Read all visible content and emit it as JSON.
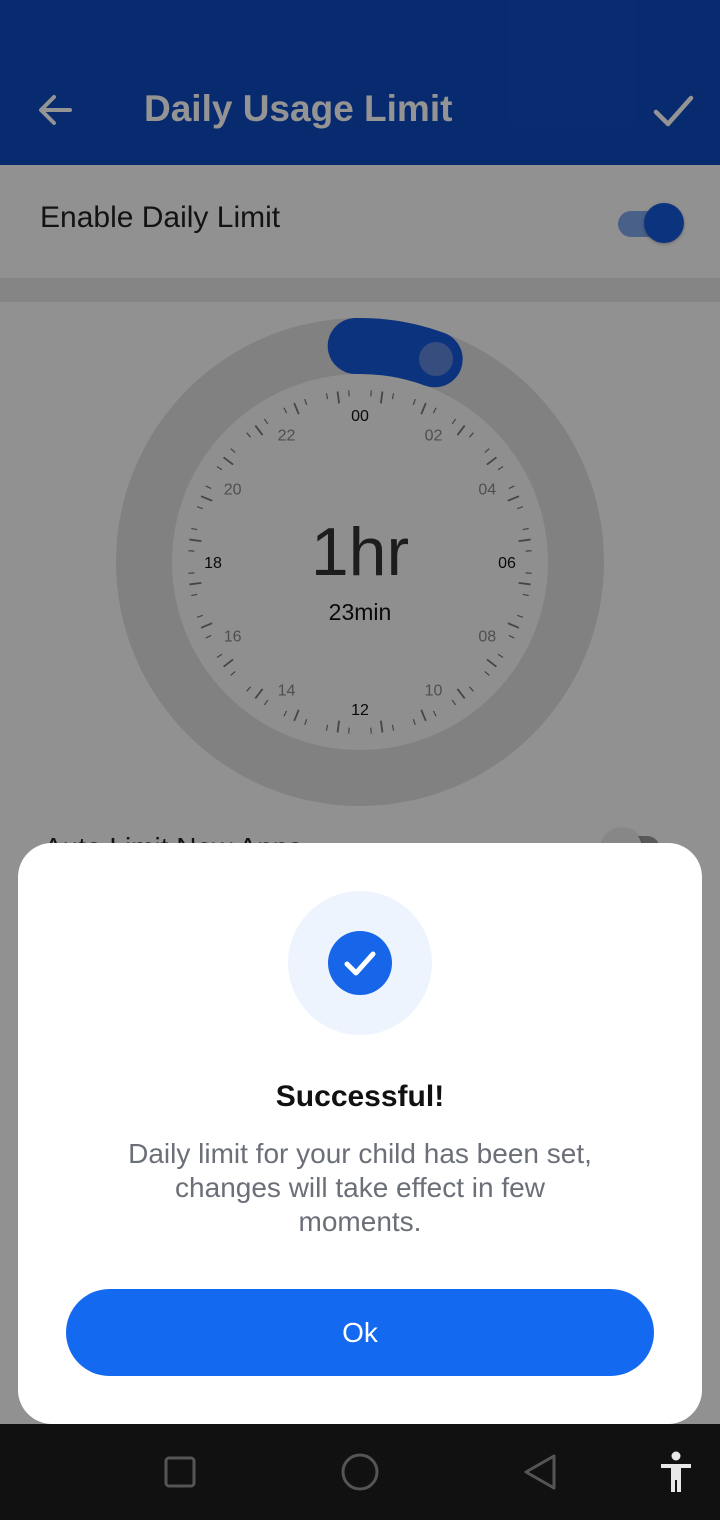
{
  "header": {
    "title": "Daily Usage Limit",
    "back_icon": "arrow-left-icon",
    "confirm_icon": "check-icon",
    "bg": "#0f4ac0"
  },
  "settings": {
    "enable_label": "Enable Daily Limit",
    "enable_on": true,
    "auto_label": "Auto Limit New Apps",
    "auto_on": false
  },
  "dial": {
    "hours_labels": [
      "00",
      "02",
      "04",
      "06",
      "08",
      "10",
      "12",
      "14",
      "16",
      "18",
      "20",
      "22"
    ],
    "value_main": "1hr",
    "value_sub": "23min",
    "accent": "#1459d9"
  },
  "dialog": {
    "title": "Successful!",
    "message": "Daily limit for your child has been set, changes will take effect in few moments.",
    "ok_label": "Ok",
    "icon": "check-circle-icon",
    "accent": "#1765e8"
  },
  "nav": {
    "icons": [
      "recent-apps-icon",
      "home-icon",
      "back-icon",
      "accessibility-icon"
    ]
  }
}
